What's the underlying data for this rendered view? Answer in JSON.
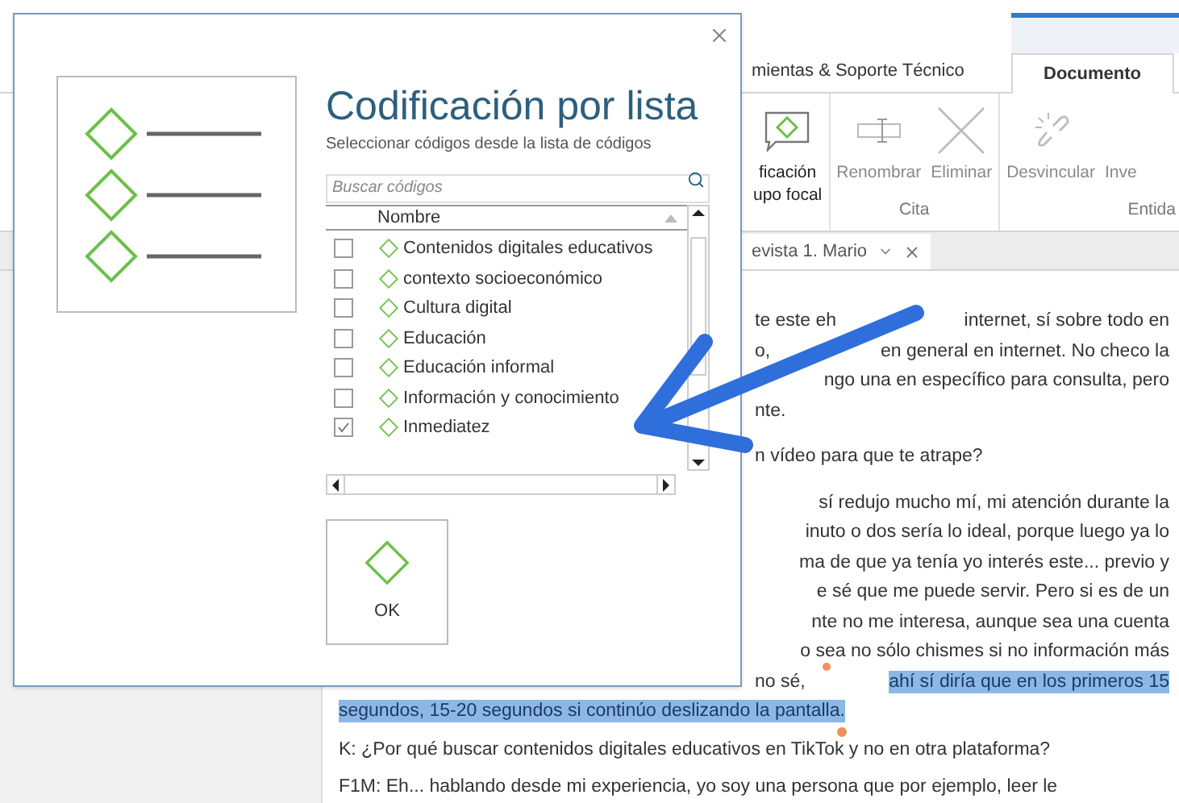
{
  "ribbon": {
    "tabs": [
      {
        "label": "mientas & Soporte Técnico",
        "selected": false
      },
      {
        "label": "Documento",
        "selected": true
      }
    ],
    "groups": [
      {
        "buttons": [
          {
            "kind": "code",
            "lines": [
              "ficación",
              "upo focal"
            ],
            "disabled": false
          }
        ]
      },
      {
        "label": "Cita",
        "buttons": [
          {
            "kind": "rename",
            "lines": [
              "Renombrar"
            ],
            "disabled": true
          },
          {
            "kind": "delete",
            "lines": [
              "Eliminar"
            ],
            "disabled": true
          }
        ]
      },
      {
        "label": "Entida",
        "buttons": [
          {
            "kind": "unlink",
            "lines": [
              "Desvincular"
            ],
            "disabled": true
          },
          {
            "kind": "plain",
            "lines": [
              "Inve"
            ],
            "disabled": true
          }
        ]
      }
    ]
  },
  "document_tab": {
    "label": "evista 1. Mario"
  },
  "document": {
    "paragraphs_beside_dialog": [
      {
        "lines": [
          {
            "segments": [
              {
                "text": "te este eh",
                "highlighted": false
              },
              {
                "text": "internet, sí sobre todo en",
                "highlighted": false
              }
            ]
          },
          {
            "segments": [
              {
                "text": "o,",
                "highlighted": false
              },
              {
                "text": "en general en internet. No checo la",
                "highlighted": false
              }
            ]
          },
          {
            "segments": [
              {
                "text": "ngo una en específico para consulta, pero",
                "highlighted": false
              }
            ]
          },
          {
            "segments": [
              {
                "text": "nte.",
                "highlighted": false
              }
            ]
          }
        ]
      },
      {
        "lines": [
          {
            "segments": [
              {
                "text": "n vídeo para que te atrape?",
                "highlighted": false
              }
            ]
          }
        ]
      },
      {
        "lines": [
          {
            "segments": [
              {
                "text": "sí redujo mucho mí, mi atención durante la",
                "highlighted": false
              }
            ]
          },
          {
            "segments": [
              {
                "text": "inuto o dos sería lo ideal, porque luego ya lo",
                "highlighted": false
              }
            ]
          },
          {
            "segments": [
              {
                "text": "ma de que ya tenía yo interés este... previo y",
                "highlighted": false
              }
            ]
          },
          {
            "segments": [
              {
                "text": "e sé que me puede servir. Pero si es de un",
                "highlighted": false
              }
            ]
          },
          {
            "segments": [
              {
                "text": "nte no me interesa, aunque sea una cuenta",
                "highlighted": false
              }
            ]
          },
          {
            "segments": [
              {
                "text": "o sea no sólo chismes si no información más",
                "highlighted": false
              }
            ]
          },
          {
            "segments": [
              {
                "text": "no sé,",
                "highlighted": false
              },
              {
                "text": "ahí sí diría que en los primeros 15",
                "highlighted": true
              }
            ]
          }
        ]
      }
    ],
    "lines": [
      {
        "segments": [
          {
            "text": "segundos, 15-20 segundos si continúo deslizando la pantalla.",
            "highlighted": true
          }
        ]
      },
      {
        "segments": [
          {
            "text": "K: ¿Por qué buscar contenidos digitales educativos en TikTok y no en otra plataforma?",
            "highlighted": false
          }
        ]
      },
      {
        "segments": [
          {
            "text": "F1M: Eh... hablando desde mi experiencia, yo soy una persona que por ejemplo, leer le",
            "highlighted": false
          }
        ]
      }
    ]
  },
  "dialog": {
    "title": "Codificación por lista",
    "subtitle": "Seleccionar códigos desde la lista de códigos",
    "search": {
      "placeholder": "Buscar códigos"
    },
    "column_header": "Nombre",
    "codes": [
      {
        "name": "Contenidos digitales educativos",
        "checked": false
      },
      {
        "name": "contexto socioeconómico",
        "checked": false
      },
      {
        "name": "Cultura digital",
        "checked": false
      },
      {
        "name": "Educación",
        "checked": false
      },
      {
        "name": "Educación informal",
        "checked": false
      },
      {
        "name": "Información y conocimiento",
        "checked": false
      },
      {
        "name": "Inmediatez",
        "checked": true
      }
    ],
    "ok_button": "OK"
  }
}
